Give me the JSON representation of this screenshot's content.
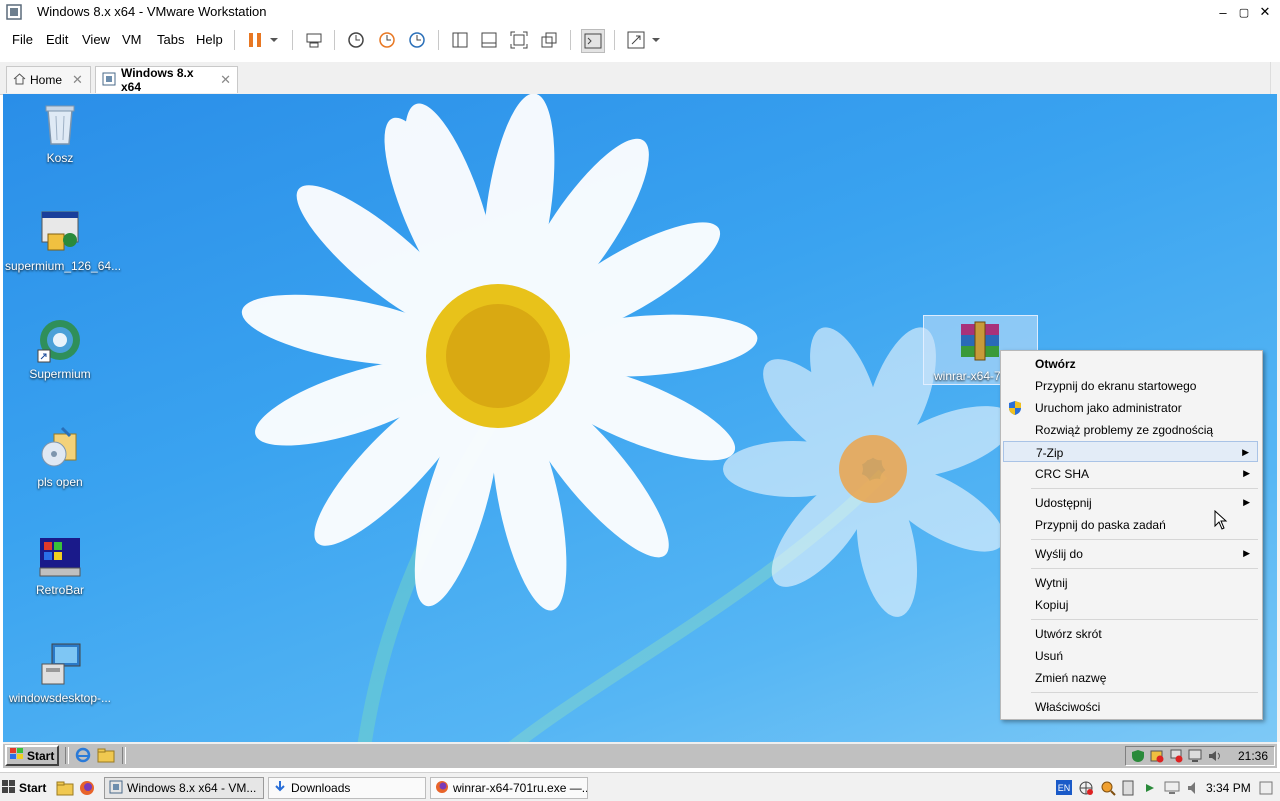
{
  "window": {
    "title": "Windows 8.x x64 - VMware Workstation",
    "controls": {
      "minimize": "–",
      "maximize": "▢",
      "close": "✕"
    }
  },
  "menu": {
    "items": [
      "File",
      "Edit",
      "View",
      "VM",
      "Tabs",
      "Help"
    ]
  },
  "tabs": [
    {
      "label": "Home"
    },
    {
      "label": "Windows 8.x x64"
    }
  ],
  "desktop": {
    "icons": [
      {
        "label": "Kosz",
        "icon": "recycle-bin-icon"
      },
      {
        "label": "supermium_126_64...",
        "icon": "installer-icon"
      },
      {
        "label": "Supermium",
        "icon": "browser-icon"
      },
      {
        "label": "pls open",
        "icon": "setup-icon"
      },
      {
        "label": "RetroBar",
        "icon": "retrobar-icon"
      },
      {
        "label": "windowsdesktop-...",
        "icon": "computer-installer-icon"
      }
    ],
    "selected_icon": {
      "label": "winrar-x64-7",
      "icon": "winrar-icon"
    }
  },
  "context_menu": {
    "items": [
      {
        "label": "Otwórz",
        "bold": true
      },
      {
        "label": "Przypnij do ekranu startowego"
      },
      {
        "label": "Uruchom jako administrator",
        "icon": "shield-icon"
      },
      {
        "label": "Rozwiąż problemy ze zgodnością"
      },
      {
        "label": "7-Zip",
        "submenu": true,
        "highlighted": true
      },
      {
        "label": "CRC SHA",
        "submenu": true
      },
      {
        "label": "Udostępnij",
        "submenu": true
      },
      {
        "label": "Przypnij do paska zadań"
      },
      {
        "label": "Wyślij do",
        "submenu": true
      },
      {
        "label": "Wytnij"
      },
      {
        "label": "Kopiuj"
      },
      {
        "label": "Utwórz skrót"
      },
      {
        "label": "Usuń"
      },
      {
        "label": "Zmień nazwę"
      },
      {
        "label": "Właściwości"
      }
    ]
  },
  "guest_taskbar": {
    "start_label": "Start",
    "clock": "21:36"
  },
  "host_taskbar": {
    "start_label": "Start",
    "buttons": [
      {
        "label": "Windows 8.x x64 - VM..."
      },
      {
        "label": "Downloads"
      },
      {
        "label": "winrar-x64-701ru.exe —..."
      }
    ],
    "language": "EN",
    "clock": "3:34 PM"
  },
  "colors": {
    "accent": "#e87722",
    "desktop": "#3aa3f0",
    "highlight": "#e3ecf7"
  }
}
